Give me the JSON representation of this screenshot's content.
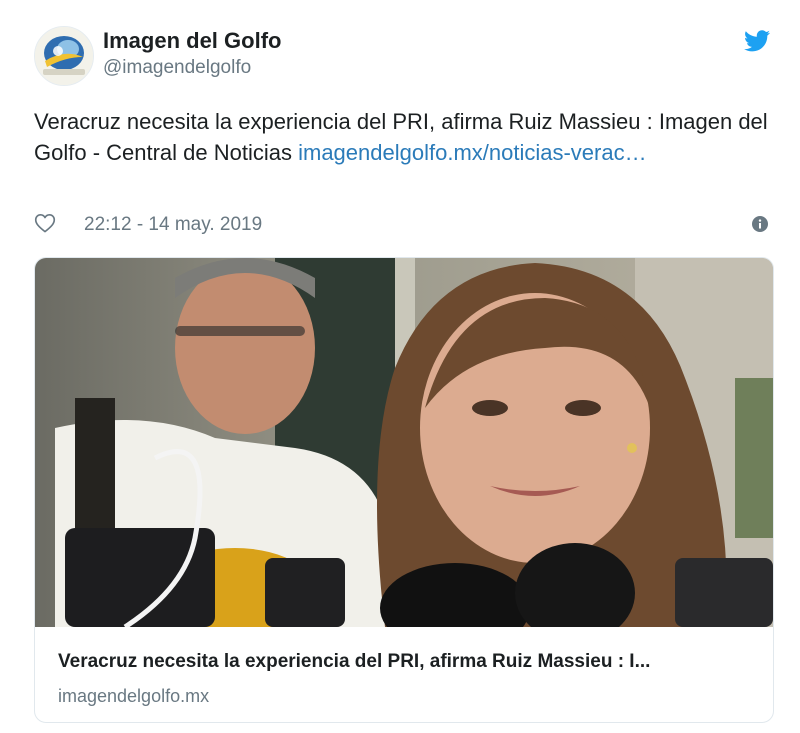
{
  "account": {
    "name": "Imagen del Golfo",
    "handle": "@imagendelgolfo"
  },
  "icons": {
    "platform": "twitter-bird-icon",
    "like": "heart-outline-icon",
    "info": "info-circle-icon"
  },
  "colors": {
    "link": "#2b7bb9",
    "twitter_blue": "#1da1f2",
    "muted": "#697882"
  },
  "tweet": {
    "text": "Veracruz necesita la experiencia del PRI, afirma Ruiz Massieu : Imagen del Golfo - Central de Noticias ",
    "link_text": "imagendelgolfo.mx/noticias-verac…",
    "timestamp": "22:12 - 14 may. 2019"
  },
  "card": {
    "title": "Veracruz necesita la experiencia del PRI, afirma Ruiz Massieu : I...",
    "domain": "imagendelgolfo.mx"
  }
}
